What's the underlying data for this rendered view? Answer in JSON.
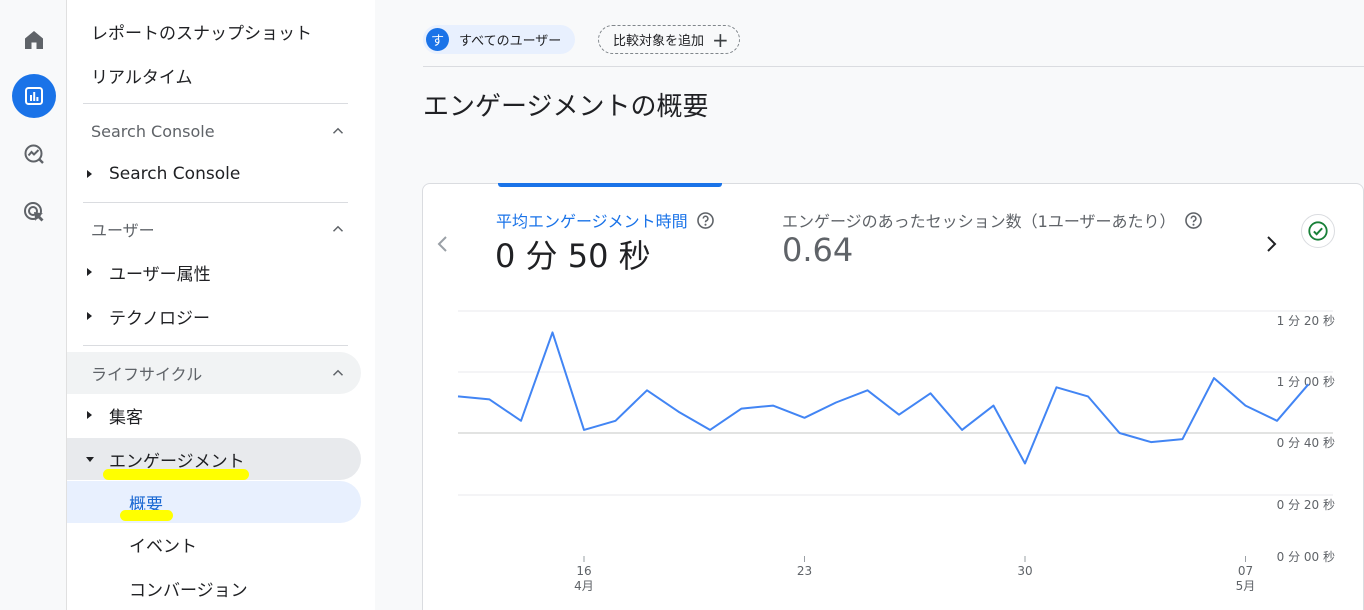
{
  "rail": {
    "items": [
      {
        "icon": "home-icon"
      },
      {
        "icon": "reports-icon",
        "active": true
      },
      {
        "icon": "explore-icon"
      },
      {
        "icon": "advertising-icon"
      }
    ]
  },
  "sidebar": {
    "snapshot": "レポートのスナップショット",
    "realtime": "リアルタイム",
    "sections": {
      "search_console": {
        "title": "Search Console",
        "child": "Search Console"
      },
      "user": {
        "title": "ユーザー",
        "children": [
          "ユーザー属性",
          "テクノロジー"
        ]
      },
      "lifecycle": {
        "title": "ライフサイクル",
        "acquisition": "集客",
        "engagement": "エンゲージメント",
        "engagement_children": [
          "概要",
          "イベント",
          "コンバージョン"
        ]
      }
    }
  },
  "header": {
    "user_chip_avatar": "す",
    "user_chip_label": "すべてのユーザー",
    "add_compare_label": "比較対象を追加",
    "title": "エンゲージメントの概要"
  },
  "card": {
    "metric1": {
      "label": "平均エンゲージメント時間",
      "value": "0 分 50 秒"
    },
    "metric2": {
      "label": "エンゲージのあったセッション数（1ユーザーあたり）",
      "value": "0.64"
    }
  },
  "colors": {
    "accent": "#1a73e8",
    "line": "#4285f4",
    "highlight": "#ffff00",
    "check": "#188038"
  },
  "chart_data": {
    "type": "line",
    "series": [
      {
        "values": [
          52,
          51,
          44,
          73,
          41,
          44,
          54,
          47,
          41,
          48,
          49,
          45,
          50,
          54,
          46,
          53,
          41,
          49,
          30,
          55,
          52,
          40,
          37,
          38,
          58,
          49,
          44,
          56
        ]
      }
    ],
    "unit": "seconds",
    "ylim": [
      0,
      80
    ],
    "y_ticks": [
      "1 分 20 秒",
      "1 分 00 秒",
      "0 分 40 秒",
      "0 分 20 秒",
      "0 分 00 秒"
    ],
    "x_ticks": [
      {
        "day": "16",
        "month": "4月"
      },
      {
        "day": "23",
        "month": ""
      },
      {
        "day": "30",
        "month": ""
      },
      {
        "day": "07",
        "month": "5月"
      }
    ],
    "x_tick_index": [
      4,
      11,
      18,
      25
    ],
    "grid": true
  }
}
